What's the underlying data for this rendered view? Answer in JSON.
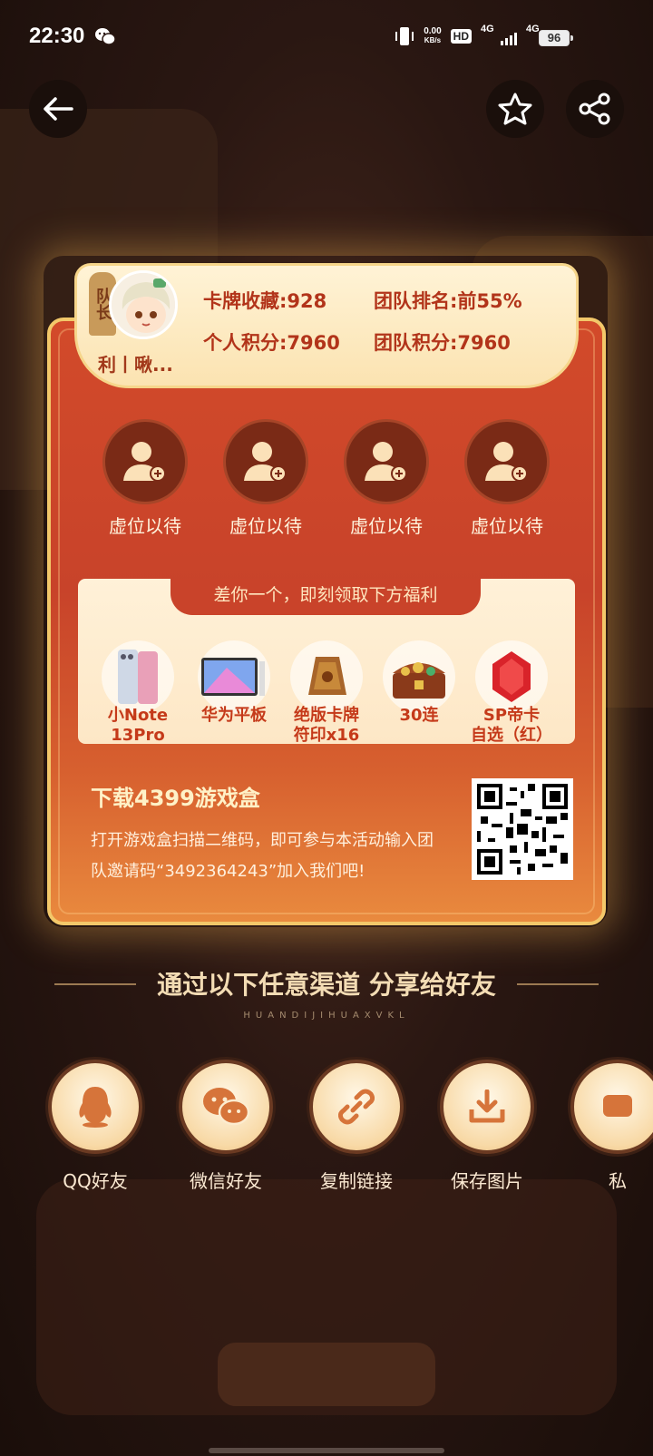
{
  "status_bar": {
    "time": "22:30",
    "net_speed_value": "0.00",
    "net_speed_unit": "KB/s",
    "hd_label": "HD",
    "sim1_label": "4G",
    "sim2_label": "4G",
    "battery": "96"
  },
  "top_actions": {
    "back_icon": "arrow-left-icon",
    "favorite_icon": "star-icon",
    "share_icon": "share-icon"
  },
  "team": {
    "leader_tag": "队长",
    "nickname": "利丨啾...",
    "card_collection": "卡牌收藏:928",
    "team_rank": "团队排名:前55%",
    "personal_points": "个人积分:7960",
    "team_points": "团队积分:7960"
  },
  "slots": [
    {
      "label": "虚位以待"
    },
    {
      "label": "虚位以待"
    },
    {
      "label": "虚位以待"
    },
    {
      "label": "虚位以待"
    }
  ],
  "rewards": {
    "banner": "差你一个，即刻领取下方福利",
    "items": [
      {
        "line1": "小Note",
        "line2": "13Pro"
      },
      {
        "line1": "华为平板",
        "line2": ""
      },
      {
        "line1": "绝版卡牌",
        "line2": "符印x16"
      },
      {
        "line1": "30连",
        "line2": ""
      },
      {
        "line1": "SP帝卡",
        "line2": "自选（红）"
      }
    ]
  },
  "download": {
    "title": "下载4399游戏盒",
    "desc": "打开游戏盒扫描二维码，即可参与本活动输入团队邀请码“3492364243”加入我们吧!"
  },
  "share": {
    "title": "通过以下任意渠道 分享给好友",
    "subtitle": "HUANDIJIHUAXVKL",
    "buttons": [
      {
        "label": "QQ好友",
        "icon": "qq-icon"
      },
      {
        "label": "微信好友",
        "icon": "wechat-icon"
      },
      {
        "label": "复制链接",
        "icon": "link-icon"
      },
      {
        "label": "保存图片",
        "icon": "download-icon"
      },
      {
        "label": "私",
        "icon": "message-icon"
      }
    ]
  }
}
